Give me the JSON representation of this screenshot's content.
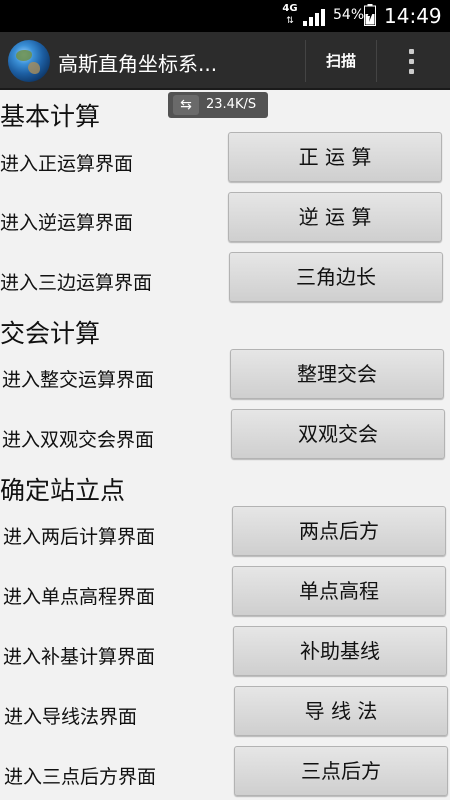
{
  "status_bar": {
    "network": "4G",
    "battery_pct": "54%",
    "time": "14:49"
  },
  "app_bar": {
    "title": "高斯直角坐标系...",
    "scan_label": "扫描"
  },
  "speed_overlay": {
    "value": "23.4K/S"
  },
  "sections": [
    {
      "title": "基本计算",
      "rows": [
        {
          "label": "进入正运算界面",
          "button": "正 运 算"
        },
        {
          "label": "进入逆运算界面",
          "button": "逆 运 算"
        },
        {
          "label": "进入三边运算界面",
          "button": "三角边长"
        }
      ]
    },
    {
      "title": "交会计算",
      "rows": [
        {
          "label": "进入整交运算界面",
          "button": "整理交会"
        },
        {
          "label": "进入双观交会界面",
          "button": "双观交会"
        }
      ]
    },
    {
      "title": "确定站立点",
      "rows": [
        {
          "label": "进入两后计算界面",
          "button": "两点后方"
        },
        {
          "label": "进入单点高程界面",
          "button": "单点高程"
        },
        {
          "label": "进入补基计算界面",
          "button": "补助基线"
        },
        {
          "label": "进入导线法界面",
          "button": "导 线 法"
        },
        {
          "label": "进入三点后方界面",
          "button": "三点后方"
        }
      ]
    }
  ]
}
